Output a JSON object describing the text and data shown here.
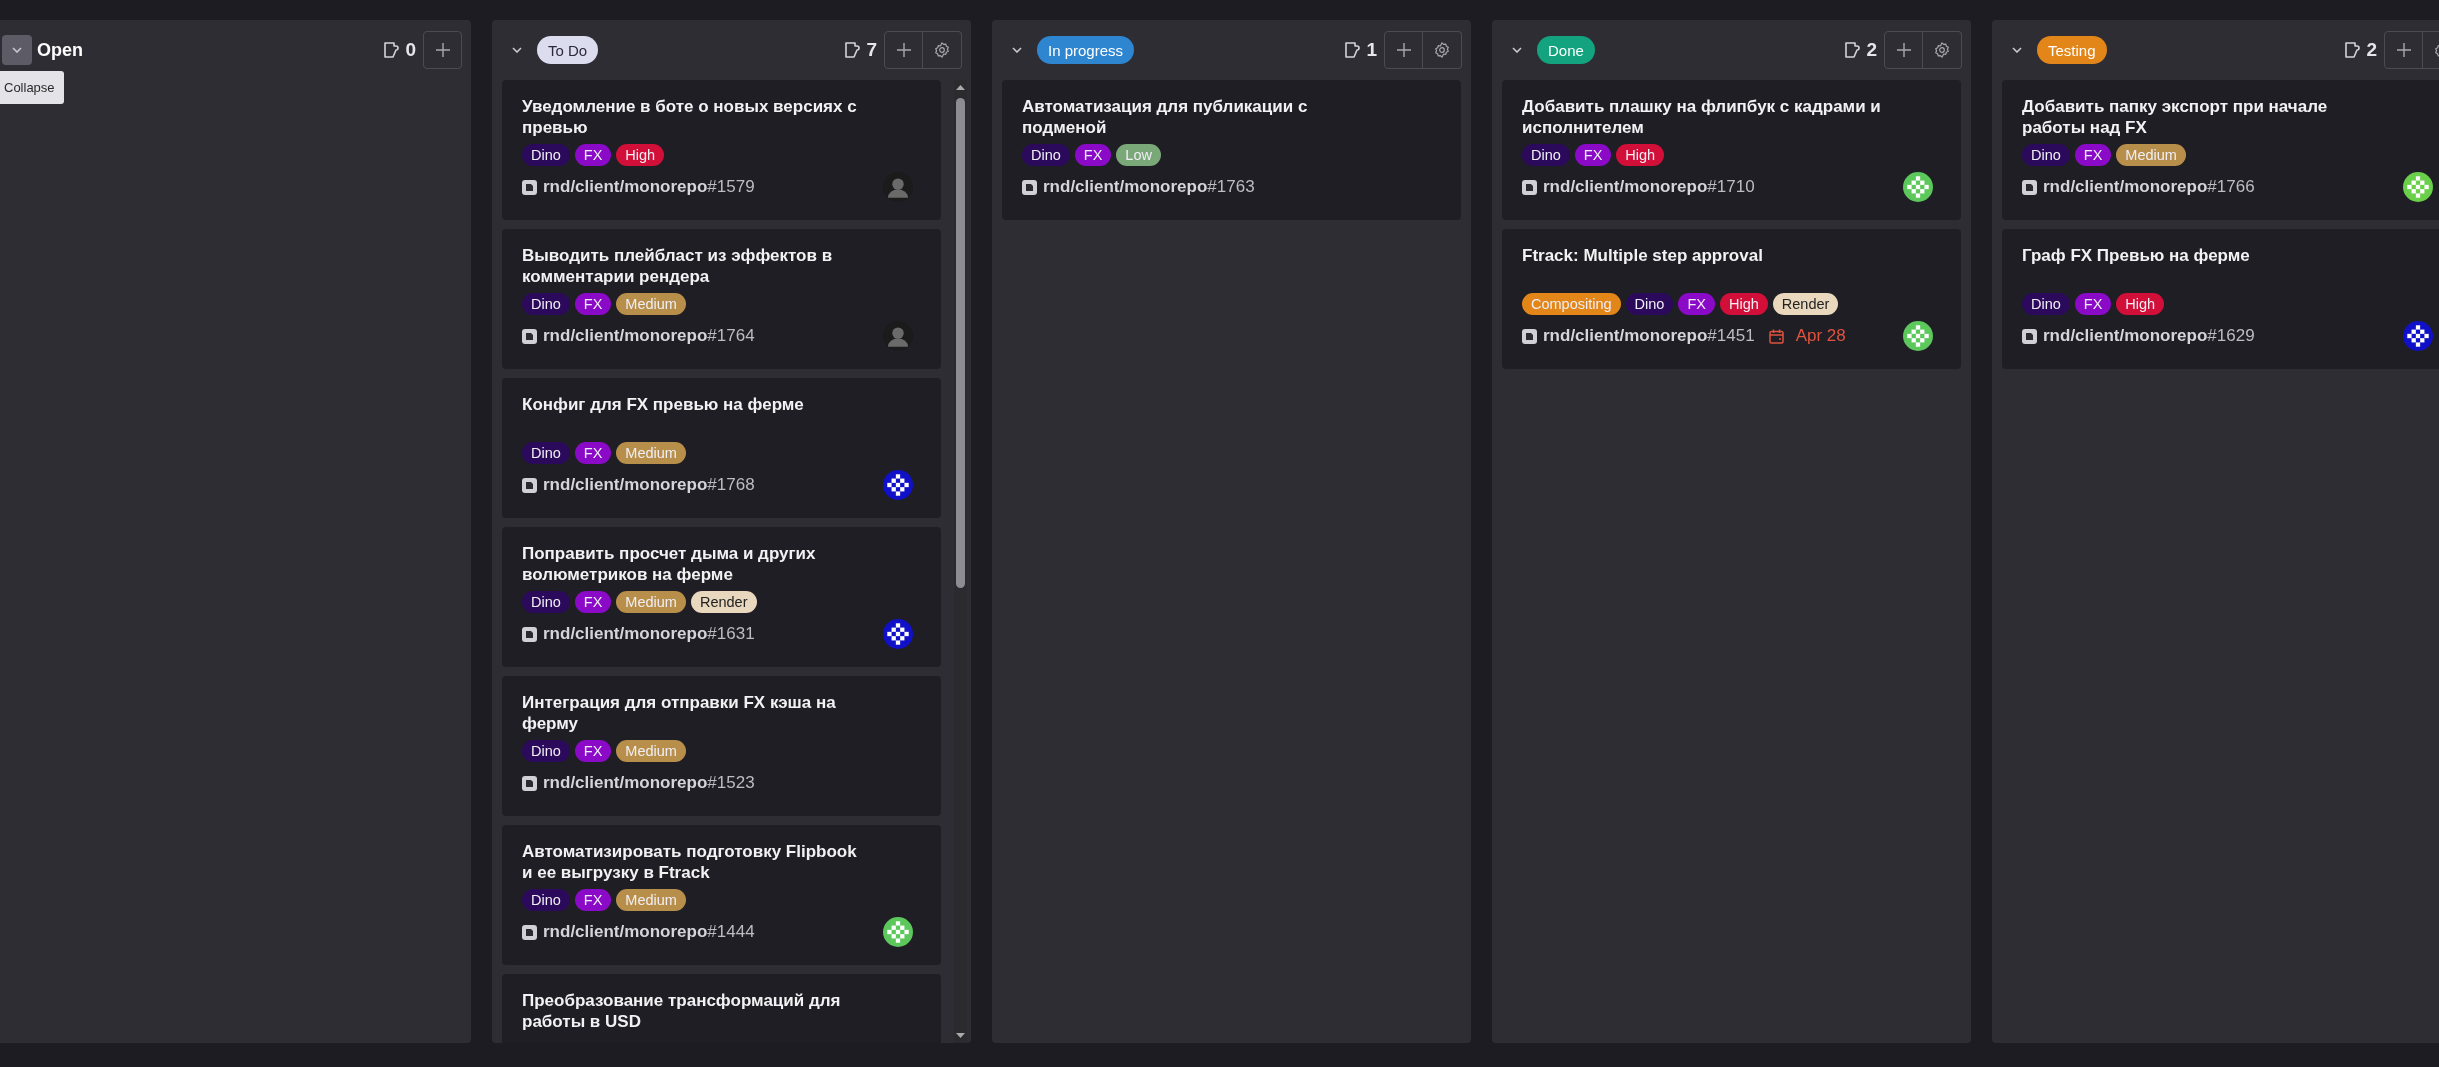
{
  "tooltip": "Collapse",
  "columns": [
    {
      "title": "Open",
      "collapse_highlighted": true,
      "count": "0",
      "settings": false,
      "scrollbar": false
    },
    {
      "title": "To Do",
      "color": "#dcdcef",
      "collapse_highlighted": false,
      "count": "7",
      "settings": true,
      "scrollbar": true,
      "cards": [
        {
          "title": "Уведомление в боте о новых версиях с превью",
          "tags": [
            {
              "label": "Dino",
              "color": "#2b0a5c"
            },
            {
              "label": "FX",
              "color": "#8a0ac8"
            },
            {
              "label": "High",
              "color": "#d20f39"
            }
          ],
          "ref": "**rnd/client/monorepo**#1579",
          "avatar": {
            "kind": "photo"
          }
        },
        {
          "title": "Выводить плейбласт из эффектов в комментарии рендера",
          "tags": [
            {
              "label": "Dino",
              "color": "#2b0a5c"
            },
            {
              "label": "FX",
              "color": "#8a0ac8"
            },
            {
              "label": "Medium",
              "color": "#b88f4a"
            }
          ],
          "ref": "**rnd/client/monorepo**#1764",
          "avatar": {
            "kind": "photo"
          }
        },
        {
          "title": "Конфиг для FX превью на ферме",
          "tags": [
            {
              "label": "Dino",
              "color": "#2b0a5c"
            },
            {
              "label": "FX",
              "color": "#8a0ac8"
            },
            {
              "label": "Medium",
              "color": "#b88f4a"
            }
          ],
          "ref": "**rnd/client/monorepo**#1768",
          "avatar": {
            "kind": "identicon",
            "color": "#1010c8"
          }
        },
        {
          "title": "Поправить просчет дыма и других волюметриков на ферме",
          "tags": [
            {
              "label": "Dino",
              "color": "#2b0a5c"
            },
            {
              "label": "FX",
              "color": "#8a0ac8"
            },
            {
              "label": "Medium",
              "color": "#b88f4a"
            },
            {
              "label": "Render",
              "color": "#e9d8bd"
            }
          ],
          "ref": "**rnd/client/monorepo**#1631",
          "avatar": {
            "kind": "identicon",
            "color": "#1010c8"
          }
        },
        {
          "title": "Интеграция для отправки FX кэша на ферму",
          "tags": [
            {
              "label": "Dino",
              "color": "#2b0a5c"
            },
            {
              "label": "FX",
              "color": "#8a0ac8"
            },
            {
              "label": "Medium",
              "color": "#b88f4a"
            }
          ],
          "ref": "**rnd/client/monorepo**#1523"
        },
        {
          "title": "Автоматизировать подготовку Flipbook и ее выгрузку в Ftrack",
          "tags": [
            {
              "label": "Dino",
              "color": "#2b0a5c"
            },
            {
              "label": "FX",
              "color": "#8a0ac8"
            },
            {
              "label": "Medium",
              "color": "#b88f4a"
            }
          ],
          "ref": "**rnd/client/monorepo**#1444",
          "avatar": {
            "kind": "identicon",
            "color": "#5cc85c"
          }
        },
        {
          "title": "Преобразование трансформаций для работы в USD"
        }
      ]
    },
    {
      "title": "In progress",
      "color": "#2f86d0",
      "collapse_highlighted": false,
      "count": "1",
      "settings": true,
      "scrollbar": false,
      "cards": [
        {
          "title": "Автоматизация для публикации с подменой",
          "tags": [
            {
              "label": "Dino",
              "color": "#2b0a5c"
            },
            {
              "label": "FX",
              "color": "#8a0ac8"
            },
            {
              "label": "Low",
              "color": "#7aa878"
            }
          ],
          "ref": "**rnd/client/monorepo**#1763"
        }
      ]
    },
    {
      "title": "Done",
      "color": "#13a37e",
      "collapse_highlighted": false,
      "count": "2",
      "settings": true,
      "scrollbar": false,
      "cards": [
        {
          "title": "Добавить плашку на флипбук с кадрами и исполнителем",
          "tags": [
            {
              "label": "Dino",
              "color": "#2b0a5c"
            },
            {
              "label": "FX",
              "color": "#8a0ac8"
            },
            {
              "label": "High",
              "color": "#d20f39"
            }
          ],
          "ref": "**rnd/client/monorepo**#1710",
          "avatar": {
            "kind": "identicon",
            "color": "#5cc85c"
          }
        },
        {
          "title": "Ftrack: Multiple step approval",
          "tags": [
            {
              "label": "Compositing",
              "color": "#e2861a"
            },
            {
              "label": "Dino",
              "color": "#2b0a5c"
            },
            {
              "label": "FX",
              "color": "#8a0ac8"
            },
            {
              "label": "High",
              "color": "#d20f39"
            },
            {
              "label": "Render",
              "color": "#e9d8bd"
            }
          ],
          "ref": "**rnd/client/monorepo**#1451",
          "due": "Apr 28",
          "avatar": {
            "kind": "identicon",
            "color": "#5cc85c"
          }
        }
      ]
    },
    {
      "title": "Testing",
      "color": "#e2861a",
      "collapse_highlighted": false,
      "count": "2",
      "settings": true,
      "scrollbar": false,
      "cards": [
        {
          "title": "Добавить папку экспорт при начале работы над FX",
          "tags": [
            {
              "label": "Dino",
              "color": "#2b0a5c"
            },
            {
              "label": "FX",
              "color": "#8a0ac8"
            },
            {
              "label": "Medium",
              "color": "#b88f4a"
            }
          ],
          "ref": "**rnd/client/monorepo**#1766",
          "avatar": {
            "kind": "identicon",
            "color": "#6ad04a"
          }
        },
        {
          "title": "Граф FX Превью на ферме",
          "tags": [
            {
              "label": "Dino",
              "color": "#2b0a5c"
            },
            {
              "label": "FX",
              "color": "#8a0ac8"
            },
            {
              "label": "High",
              "color": "#d20f39"
            }
          ],
          "ref": "**rnd/client/monorepo**#1629",
          "avatar": {
            "kind": "identicon",
            "color": "#1010c8"
          }
        }
      ]
    }
  ]
}
